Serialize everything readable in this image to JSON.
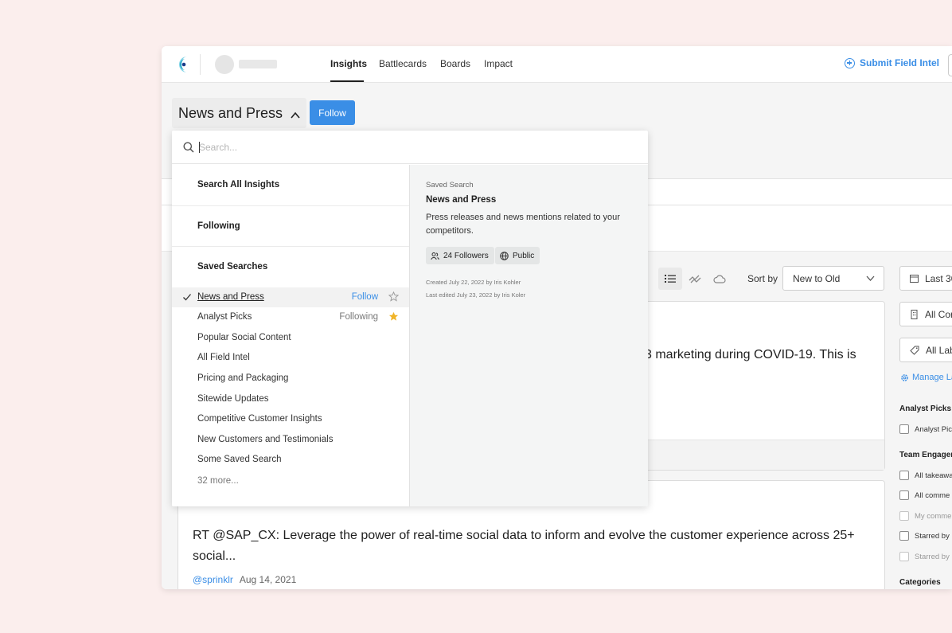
{
  "nav": {
    "tabs": [
      {
        "label": "Insights",
        "active": true
      },
      {
        "label": "Battlecards",
        "active": false
      },
      {
        "label": "Boards",
        "active": false
      },
      {
        "label": "Impact",
        "active": false
      }
    ],
    "submit_label": "Submit Field Intel"
  },
  "header": {
    "title": "News and Press",
    "follow_label": "Follow"
  },
  "dropdown": {
    "search_placeholder": "Search...",
    "sections": {
      "search_all": "Search All Insights",
      "following": "Following",
      "saved_searches": "Saved Searches"
    },
    "saved_searches": [
      {
        "label": "News and Press",
        "selected": true,
        "status": "Follow",
        "starred": false
      },
      {
        "label": "Analyst Picks",
        "selected": false,
        "status": "Following",
        "starred": true
      },
      {
        "label": "Popular Social Content",
        "selected": false,
        "status": "",
        "starred": false
      },
      {
        "label": "All Field Intel",
        "selected": false,
        "status": "",
        "starred": false
      },
      {
        "label": "Pricing and Packaging",
        "selected": false,
        "status": "",
        "starred": false
      },
      {
        "label": "Sitewide Updates",
        "selected": false,
        "status": "",
        "starred": false
      },
      {
        "label": "Competitive Customer Insights",
        "selected": false,
        "status": "",
        "starred": false
      },
      {
        "label": "New Customers and Testimonials",
        "selected": false,
        "status": "",
        "starred": false
      },
      {
        "label": "Some Saved Search",
        "selected": false,
        "status": "",
        "starred": false
      }
    ],
    "more_label": "32 more...",
    "detail": {
      "kicker": "Saved Search",
      "title": "News and Press",
      "description": "Press releases and news mentions related to your competitors.",
      "followers": "24 Followers",
      "visibility": "Public",
      "created": "Created July 22, 2022 by Iris Kohler",
      "edited": "Last edited July 23, 2022 by Iris Koler"
    }
  },
  "toolbar": {
    "sort_by_label": "Sort by",
    "sort_value": "New to Old"
  },
  "feed": {
    "card1_text": "3 marketing during COVID-19. This is",
    "card2_text": "RT @SAP_CX: Leverage the power of real-time social data to inform and evolve the customer experience across 25+ social...",
    "card2_handle": "@sprinklr",
    "card2_date": "Aug 14, 2021"
  },
  "filters": {
    "date_range": "Last 30",
    "companies": "All Cor",
    "labels": "All Lab",
    "manage_labels": "Manage La",
    "analyst_picks_title": "Analyst Picks",
    "analyst_picks_option": "Analyst Pic",
    "team_engagement_title": "Team Engager",
    "team_options": [
      {
        "label": "All takeawa",
        "dim": false
      },
      {
        "label": "All comme",
        "dim": false
      },
      {
        "label": "My comme",
        "dim": true
      },
      {
        "label": "Starred by",
        "dim": false
      },
      {
        "label": "Starred by",
        "dim": true
      }
    ],
    "categories_title": "Categories"
  },
  "colors": {
    "accent": "#3a8ee6",
    "page_background": "#fbeeed",
    "star_gold": "#f0b429"
  }
}
